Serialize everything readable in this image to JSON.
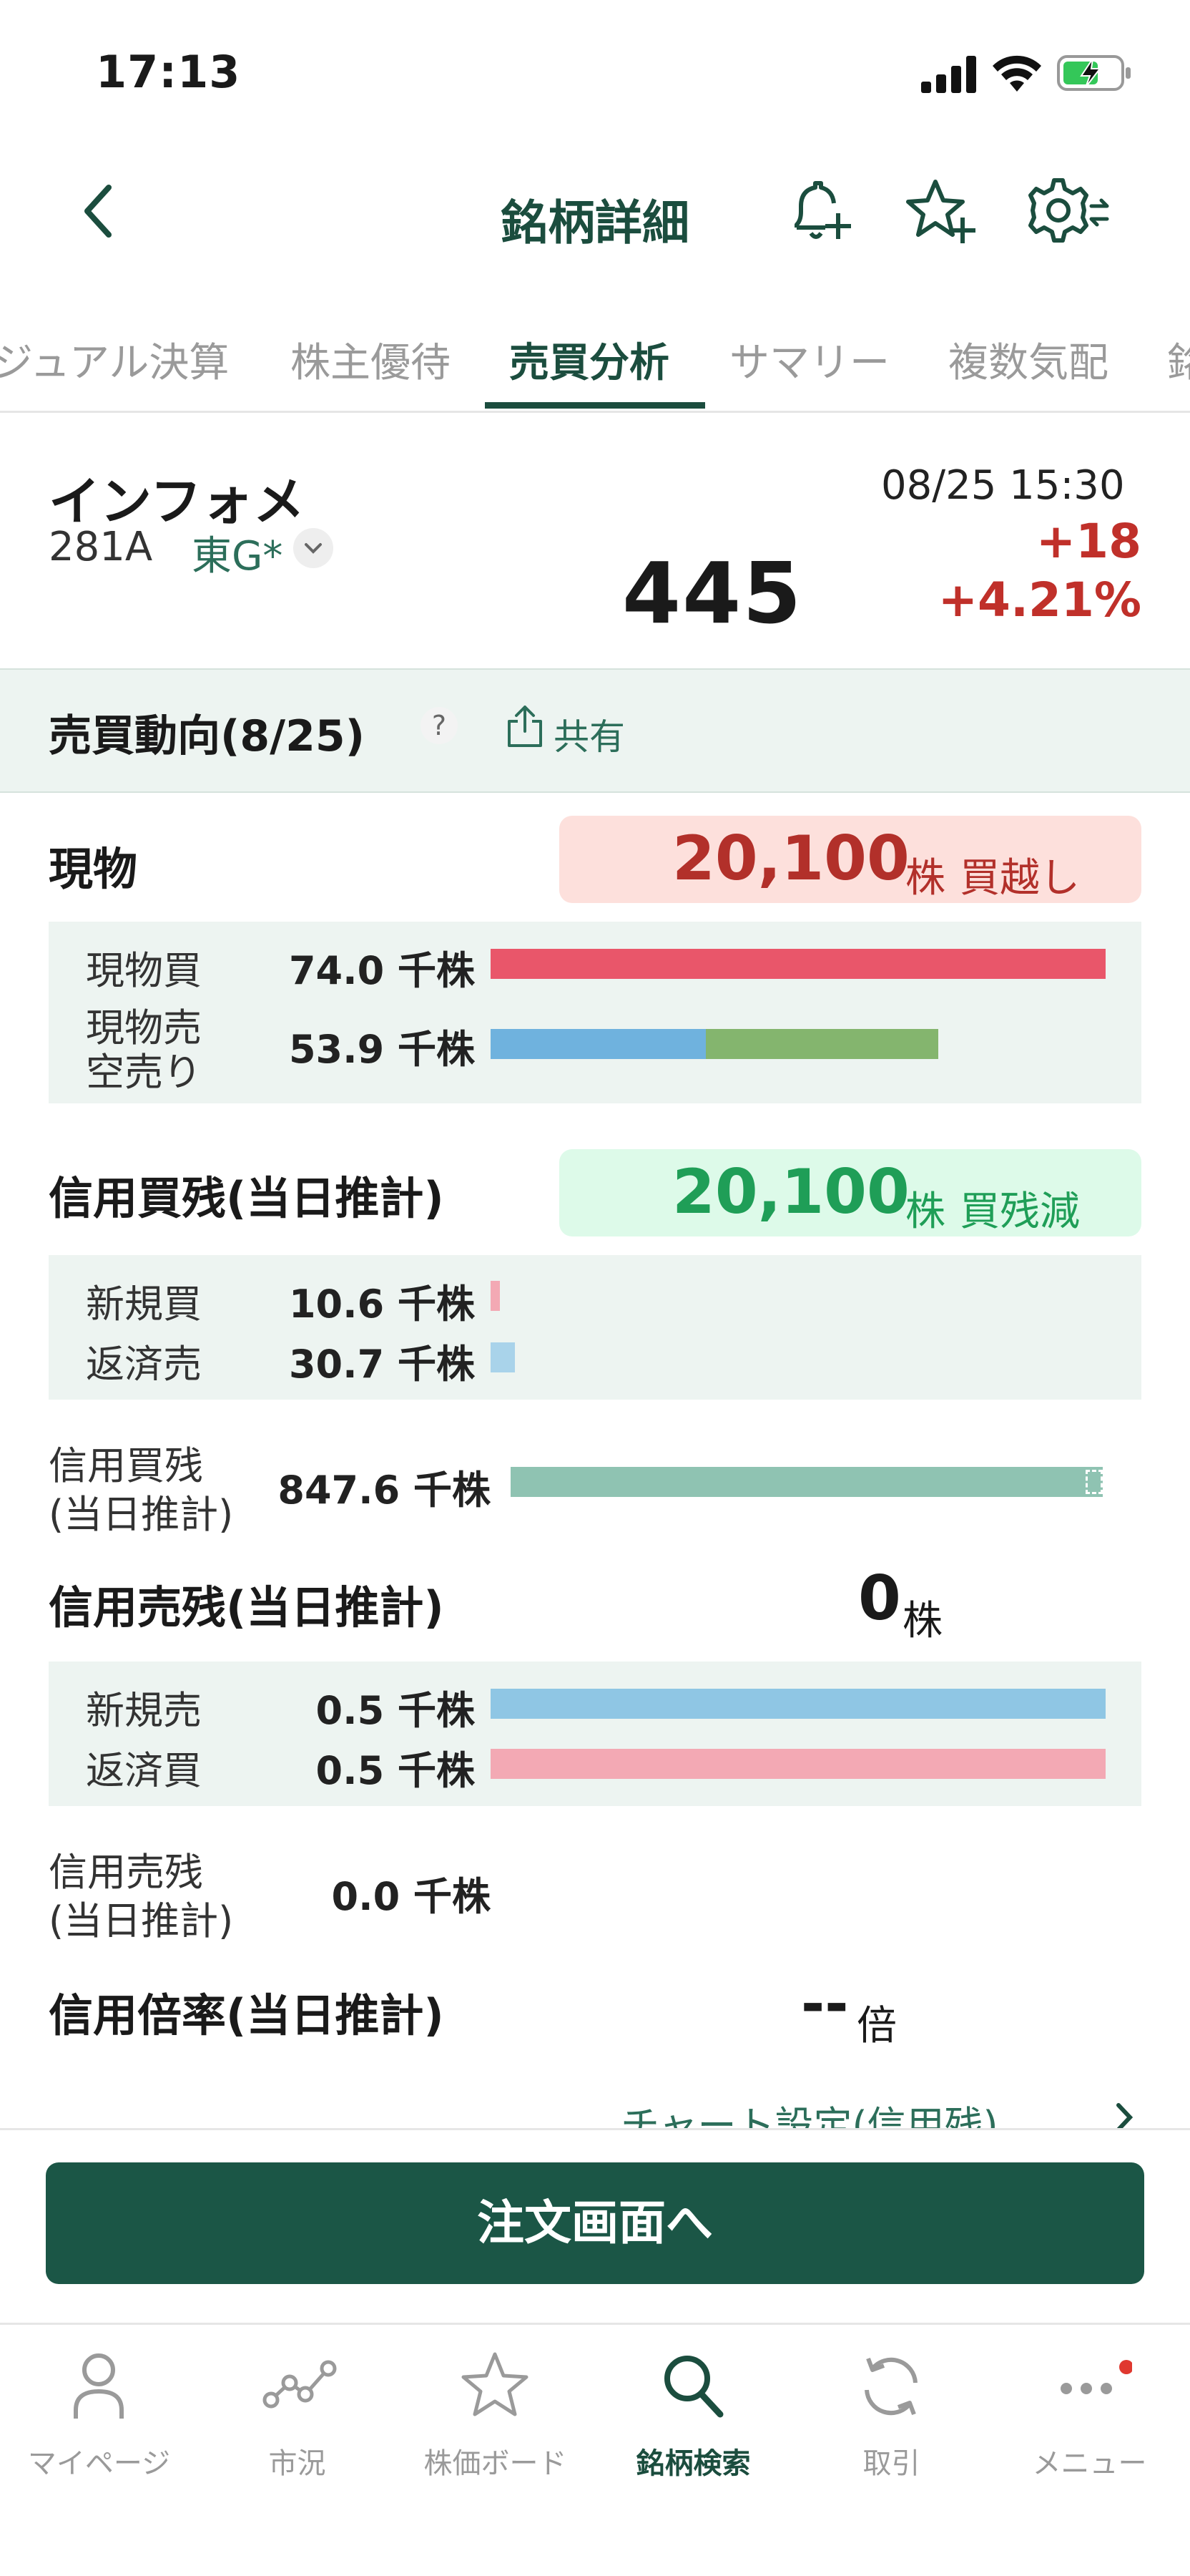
{
  "status_bar": {
    "time": "17:13"
  },
  "header": {
    "title": "銘柄詳細"
  },
  "tabs": [
    {
      "label": "ジュアル決算",
      "active": false
    },
    {
      "label": "株主優待",
      "active": false
    },
    {
      "label": "売買分析",
      "active": true
    },
    {
      "label": "サマリー",
      "active": false
    },
    {
      "label": "複数気配",
      "active": false
    },
    {
      "label": "銘",
      "active": false
    }
  ],
  "stock": {
    "name": "インフォメ",
    "code": "281A",
    "market": "東G*",
    "datetime": "08/25 15:30",
    "price": "445",
    "change": "+18",
    "change_pct": "+4.21%"
  },
  "trend": {
    "title": "売買動向(8/25)",
    "help": "?",
    "share_label": "共有"
  },
  "genbutsu": {
    "title": "現物",
    "summary_value": "20,100",
    "summary_unit": "株",
    "summary_label": "買越し",
    "rows": [
      {
        "label": "現物買",
        "qty": "74.0 千株",
        "fraction": 1.0
      },
      {
        "label": "現物売",
        "label2": "空売り",
        "qty": "53.9 千株",
        "fraction": 0.728,
        "split": 0.48
      }
    ]
  },
  "margin_buy": {
    "title": "信用買残(当日推計)",
    "summary_value": "20,100",
    "summary_unit": "株",
    "summary_label": "買残減",
    "rows": [
      {
        "label": "新規買",
        "qty": "10.6 千株",
        "fraction": 0.015
      },
      {
        "label": "返済売",
        "qty": "30.7 千株",
        "fraction": 0.04
      }
    ],
    "balance_label1": "信用買残",
    "balance_label2": "(当日推計)",
    "balance_qty": "847.6 千株"
  },
  "margin_sell": {
    "title": "信用売残(当日推計)",
    "summary_value": "0",
    "summary_unit": "株",
    "rows": [
      {
        "label": "新規売",
        "qty": "0.5 千株",
        "fraction": 1.0
      },
      {
        "label": "返済買",
        "qty": "0.5 千株",
        "fraction": 1.0
      }
    ],
    "balance_label1": "信用売残",
    "balance_label2": "(当日推計)",
    "balance_qty": "0.0 千株"
  },
  "margin_ratio": {
    "title": "信用倍率(当日推計)",
    "value": "--",
    "unit": "倍"
  },
  "chart_settings_link": "チャート設定(信用残)",
  "order_button": "注文画面へ",
  "bottom_nav": [
    {
      "label": "マイページ",
      "icon": "person-icon",
      "active": false
    },
    {
      "label": "市況",
      "icon": "market-icon",
      "active": false
    },
    {
      "label": "株価ボード",
      "icon": "star-icon",
      "active": false
    },
    {
      "label": "銘柄検索",
      "icon": "search-icon",
      "active": true
    },
    {
      "label": "取引",
      "icon": "refresh-icon",
      "active": false
    },
    {
      "label": "メニュー",
      "icon": "more-icon",
      "active": false
    }
  ],
  "colors": {
    "brand": "#1b4d3e",
    "up_red": "#c0302a",
    "buy_red": "#e9566a",
    "sell_blue": "#6fb2de",
    "short_green": "#84b56e",
    "balance_teal": "#8fc3b2",
    "buy_light": "#f3a9b4",
    "sell_light": "#a9d3ea",
    "pill_red_bg": "#fde0dc",
    "pill_green_bg": "#ddfae9",
    "pill_green_text": "#1f9e57"
  }
}
